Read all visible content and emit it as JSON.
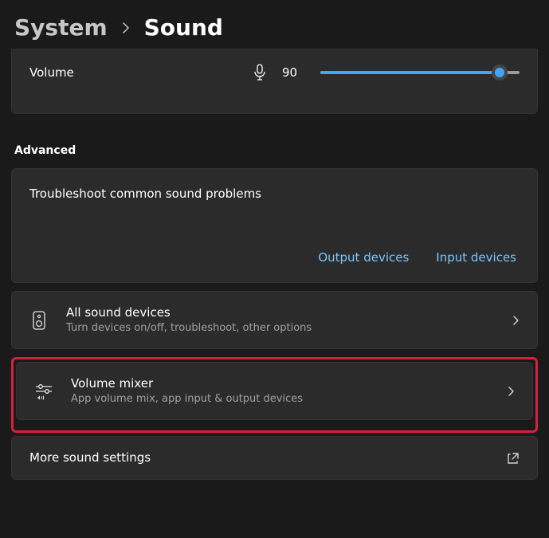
{
  "breadcrumb": {
    "parent": "System",
    "current": "Sound"
  },
  "volume": {
    "label": "Volume",
    "value": "90",
    "percent": 90
  },
  "advanced": {
    "title": "Advanced"
  },
  "troubleshoot": {
    "title": "Troubleshoot common sound problems",
    "output_link": "Output devices",
    "input_link": "Input devices"
  },
  "all_devices": {
    "title": "All sound devices",
    "subtitle": "Turn devices on/off, troubleshoot, other options"
  },
  "mixer": {
    "title": "Volume mixer",
    "subtitle": "App volume mix, app input & output devices"
  },
  "more": {
    "title": "More sound settings"
  }
}
